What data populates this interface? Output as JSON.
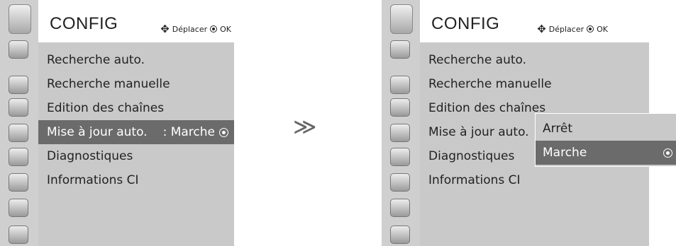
{
  "left": {
    "title": "CONFIG",
    "hint_move": "Déplacer",
    "hint_ok": "OK",
    "items": [
      {
        "label": "Recherche auto."
      },
      {
        "label": "Recherche manuelle"
      },
      {
        "label": "Edition des chaînes"
      },
      {
        "label": "Mise à jour auto.",
        "value": ": Marche"
      },
      {
        "label": "Diagnostiques"
      },
      {
        "label": "Informations CI"
      }
    ]
  },
  "arrow_glyph": "≫",
  "right": {
    "title": "CONFIG",
    "hint_move": "Déplacer",
    "hint_ok": "OK",
    "items": [
      {
        "label": "Recherche auto."
      },
      {
        "label": "Recherche manuelle"
      },
      {
        "label": "Edition des chaînes"
      },
      {
        "label": "Mise à jour auto."
      },
      {
        "label": "Diagnostiques"
      },
      {
        "label": "Informations CI"
      }
    ],
    "submenu": [
      {
        "label": "Arrêt"
      },
      {
        "label": "Marche"
      }
    ]
  },
  "icons": [
    "config-icon",
    "satellite-dish-icon",
    "tv-screen-icon",
    "speaker-icon",
    "clock-icon",
    "calendar-icon",
    "lock-icon",
    "plug-icon",
    "photo-icon"
  ],
  "colors": {
    "highlight": "#6b6b6b",
    "menu_bg": "#c9c9c9",
    "sidebar_bg": "#cfcfcf"
  }
}
